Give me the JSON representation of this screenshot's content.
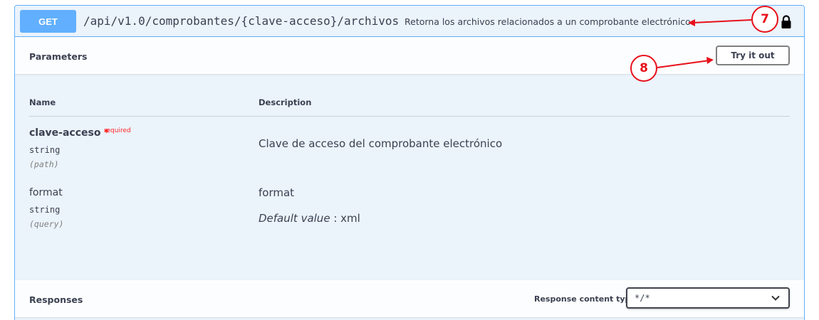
{
  "summary": {
    "method": "GET",
    "path": "/api/v1.0/comprobantes/{clave-acceso}/archivos",
    "description": "Retorna los archivos relacionados a un comprobante electrónico",
    "lock_icon": "lock-icon"
  },
  "parameters": {
    "title": "Parameters",
    "try_button": "Try it out",
    "col_name": "Name",
    "col_description": "Description",
    "items": [
      {
        "name": "clave-acceso",
        "required_star": "*",
        "required_label": "required",
        "type": "string",
        "in": "(path)",
        "description": "Clave de acceso del comprobante electrónico"
      },
      {
        "name": "format",
        "type": "string",
        "in": "(query)",
        "description": "format",
        "default_label": "Default value",
        "default_sep": " : ",
        "default_value": "xml"
      }
    ]
  },
  "responses": {
    "title": "Responses",
    "content_type_label": "Response content type",
    "content_type_value": "*/*"
  },
  "annotations": {
    "callout_7": "7",
    "callout_8": "8",
    "color": "#e8101a"
  },
  "colors": {
    "get_accent": "#61affe",
    "background": "#ebf3fb"
  }
}
